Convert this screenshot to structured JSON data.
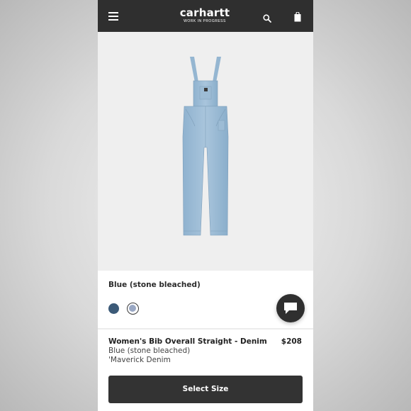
{
  "header": {
    "brand": "carhartt",
    "tagline": "WORK IN PROGRESS",
    "menu_icon": "menu-icon",
    "search_icon": "search-icon",
    "bag_icon": "shopping-bag-icon"
  },
  "product": {
    "image": "bib-overall-denim-image",
    "selected_color_label": "Blue (stone bleached)",
    "swatches": [
      {
        "name": "navy",
        "color": "#3c5a78"
      },
      {
        "name": "stone-bleached",
        "color": "#9aa8c4",
        "selected": true
      }
    ],
    "name": "Women's Bib Overall Straight - Denim",
    "price": "$208",
    "color": "Blue (stone bleached)",
    "fabric": "'Maverick Denim"
  },
  "actions": {
    "select_size_label": "Select Size",
    "chat_icon": "chat-icon"
  }
}
